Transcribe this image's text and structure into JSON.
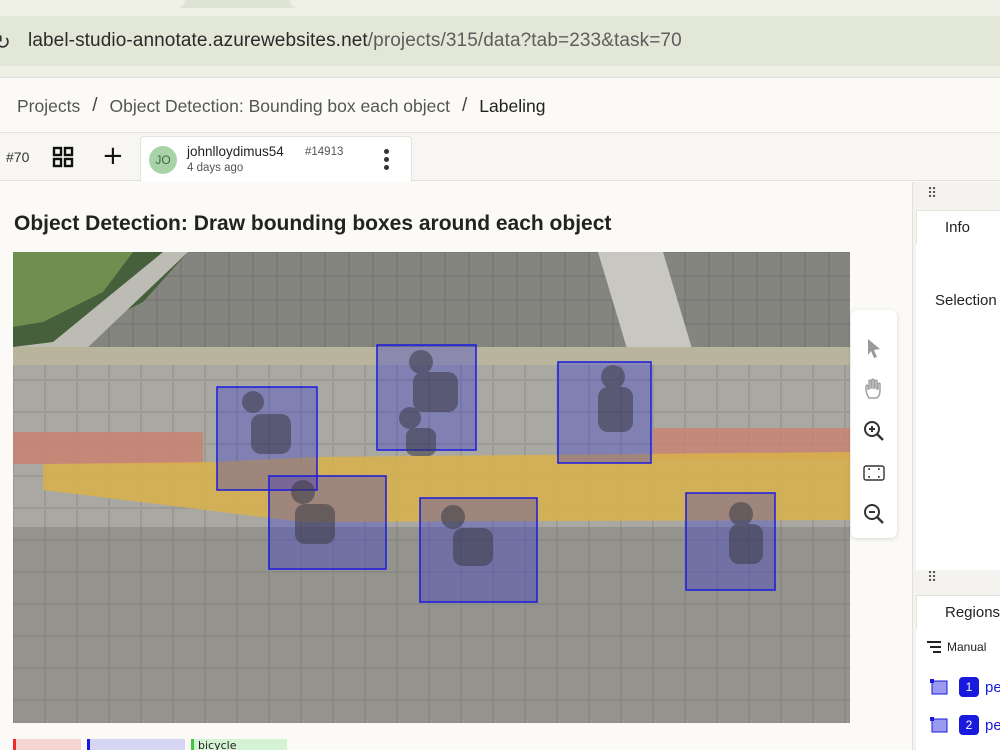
{
  "browser": {
    "reload_glyph": "↻",
    "url_host": "label-studio-annotate.azurewebsites.net",
    "url_path": "/projects/315/data?tab=233&task=70"
  },
  "breadcrumbs": {
    "items": [
      "Projects",
      "Object Detection: Bounding box each object"
    ],
    "current": "Labeling",
    "separator": "/"
  },
  "toolbar": {
    "task_id": "#70",
    "plus": "+",
    "annotation": {
      "avatar_initials": "JO",
      "user": "johnlloydimus54",
      "annotation_number": "#14913",
      "time": "4 days ago"
    }
  },
  "main": {
    "title": "Object Detection: Draw bounding boxes around each object",
    "label_chips": [
      {
        "color": "#ee2a2a",
        "bg": "#f6d4d4"
      },
      {
        "color": "#1a1adf",
        "bg": "#d6d6f4"
      },
      {
        "color": "#3ac93a",
        "bg": "#d4f2d4",
        "text": "bicycle"
      }
    ],
    "tools": [
      "pointer-icon",
      "hand-icon",
      "zoom-in-icon",
      "fit-icon",
      "zoom-out-icon"
    ],
    "region_color": "#1a1adf"
  },
  "panel": {
    "info_tab": "Info",
    "selection": "Selection",
    "regions_tab": "Regions",
    "manual": "Manual",
    "regions": [
      {
        "num": "1",
        "label": "pe"
      },
      {
        "num": "2",
        "label": "pe"
      }
    ]
  }
}
